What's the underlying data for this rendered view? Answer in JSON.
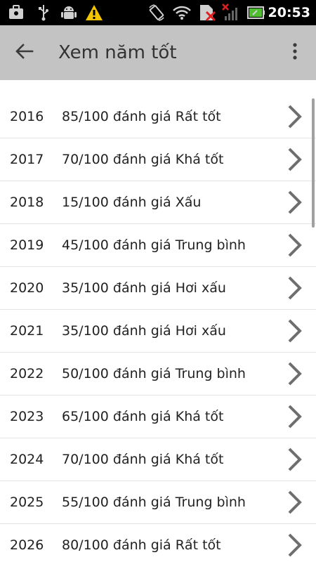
{
  "status_bar": {
    "time": "20:53",
    "icons": [
      "briefcase-icon",
      "usb-icon",
      "android-debug-icon",
      "warning-icon",
      "rotate-icon",
      "wifi-icon",
      "sim-error-icon",
      "signal-off-icon",
      "battery-icon"
    ]
  },
  "app_bar": {
    "title": "Xem năm tốt",
    "back_icon": "arrow-back-icon",
    "menu_icon": "overflow-menu-icon"
  },
  "items": [
    {
      "year": "2016",
      "desc": "85/100 đánh giá Rất tốt"
    },
    {
      "year": "2017",
      "desc": "70/100 đánh giá Khá tốt"
    },
    {
      "year": "2018",
      "desc": "15/100 đánh giá Xấu"
    },
    {
      "year": "2019",
      "desc": "45/100 đánh giá Trung bình"
    },
    {
      "year": "2020",
      "desc": "35/100 đánh giá Hơi xấu"
    },
    {
      "year": "2021",
      "desc": "35/100 đánh giá Hơi xấu"
    },
    {
      "year": "2022",
      "desc": "50/100 đánh giá Trung bình"
    },
    {
      "year": "2023",
      "desc": "65/100 đánh giá Khá tốt"
    },
    {
      "year": "2024",
      "desc": "70/100 đánh giá Khá tốt"
    },
    {
      "year": "2025",
      "desc": "55/100 đánh giá Trung bình"
    },
    {
      "year": "2026",
      "desc": "80/100 đánh giá Rất tốt"
    }
  ],
  "colors": {
    "status_bar_bg": "#000000",
    "app_bar_bg": "#c3c3c3",
    "chevron": "#6e6e6e",
    "divider": "#e3e3e3"
  }
}
